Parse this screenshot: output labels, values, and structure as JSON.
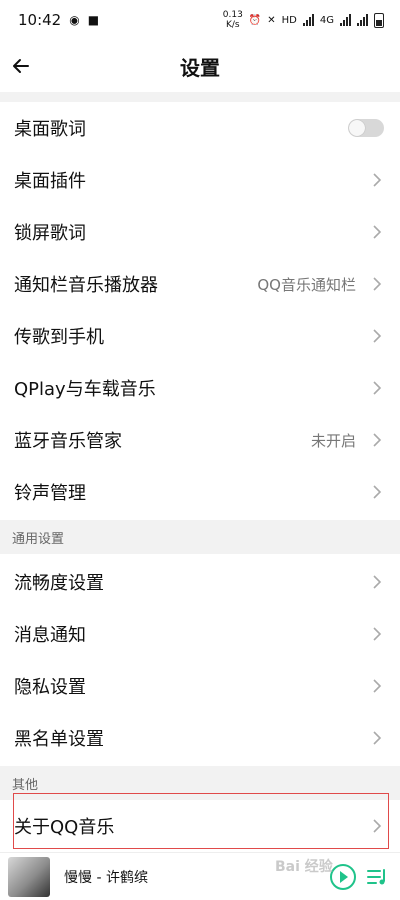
{
  "status_bar": {
    "time": "10:42",
    "net_speed_value": "0.13",
    "net_speed_unit": "K/s",
    "hd_label": "HD",
    "network_label": "4G"
  },
  "header": {
    "title": "设置"
  },
  "rows_top": [
    {
      "label": "桌面歌词",
      "control": "toggle",
      "toggle_on": false
    },
    {
      "label": "桌面插件",
      "control": "chevron"
    },
    {
      "label": "锁屏歌词",
      "control": "chevron"
    },
    {
      "label": "通知栏音乐播放器",
      "value": "QQ音乐通知栏",
      "control": "chevron"
    },
    {
      "label": "传歌到手机",
      "control": "chevron"
    },
    {
      "label": "QPlay与车载音乐",
      "control": "chevron"
    },
    {
      "label": "蓝牙音乐管家",
      "value": "未开启",
      "control": "chevron"
    },
    {
      "label": "铃声管理",
      "control": "chevron"
    }
  ],
  "section_general": {
    "title": "通用设置",
    "rows": [
      {
        "label": "流畅度设置"
      },
      {
        "label": "消息通知"
      },
      {
        "label": "隐私设置"
      },
      {
        "label": "黑名单设置"
      }
    ]
  },
  "section_other": {
    "title": "其他",
    "rows": [
      {
        "label": "关于QQ音乐"
      }
    ]
  },
  "player": {
    "song": "慢慢 - 许鹤缤"
  },
  "colors": {
    "accent": "#1fc38a",
    "highlight_border": "#e04a4a",
    "section_bg": "#f2f2f2"
  },
  "watermark": "Bai 经验"
}
